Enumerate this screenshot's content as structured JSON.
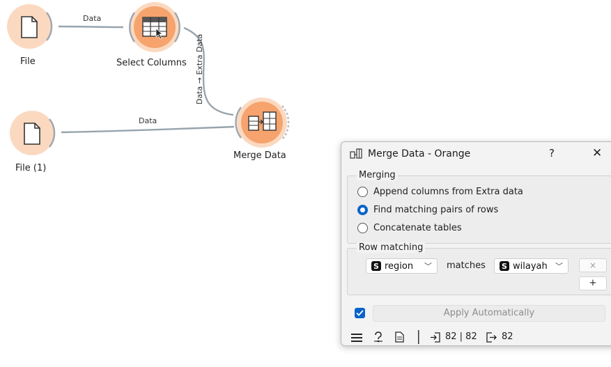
{
  "canvas": {
    "nodes": [
      {
        "id": "file",
        "label": "File"
      },
      {
        "id": "select-columns",
        "label": "Select Columns"
      },
      {
        "id": "file-1",
        "label": "File (1)"
      },
      {
        "id": "merge-data",
        "label": "Merge Data"
      }
    ],
    "links": [
      {
        "from": "file",
        "to": "select-columns",
        "label": "Data"
      },
      {
        "from": "select-columns",
        "to": "merge-data",
        "label": "Data → Extra Data"
      },
      {
        "from": "file-1",
        "to": "merge-data",
        "label": "Data"
      }
    ]
  },
  "dialog": {
    "title": "Merge Data - Orange",
    "help": "?",
    "close": "✕",
    "merging": {
      "title": "Merging",
      "options": [
        {
          "label": "Append columns from Extra data",
          "checked": false
        },
        {
          "label": "Find matching pairs of rows",
          "checked": true
        },
        {
          "label": "Concatenate tables",
          "checked": false
        }
      ]
    },
    "row_matching": {
      "title": "Row matching",
      "left_var": "region",
      "var_type_badge": "S",
      "matches_label": "matches",
      "right_var": "wilayah",
      "remove_btn": "×",
      "add_btn": "+"
    },
    "apply": {
      "label": "Apply Automatically",
      "auto_checked": true
    },
    "status": {
      "input": "82 | 82",
      "output": "82"
    }
  },
  "colors": {
    "node_fill": "#f6a36e",
    "node_halo": "#fbd9c0",
    "node_outline": "#a0a8b0",
    "link": "#98a4ad",
    "accent": "#0a63c9"
  }
}
